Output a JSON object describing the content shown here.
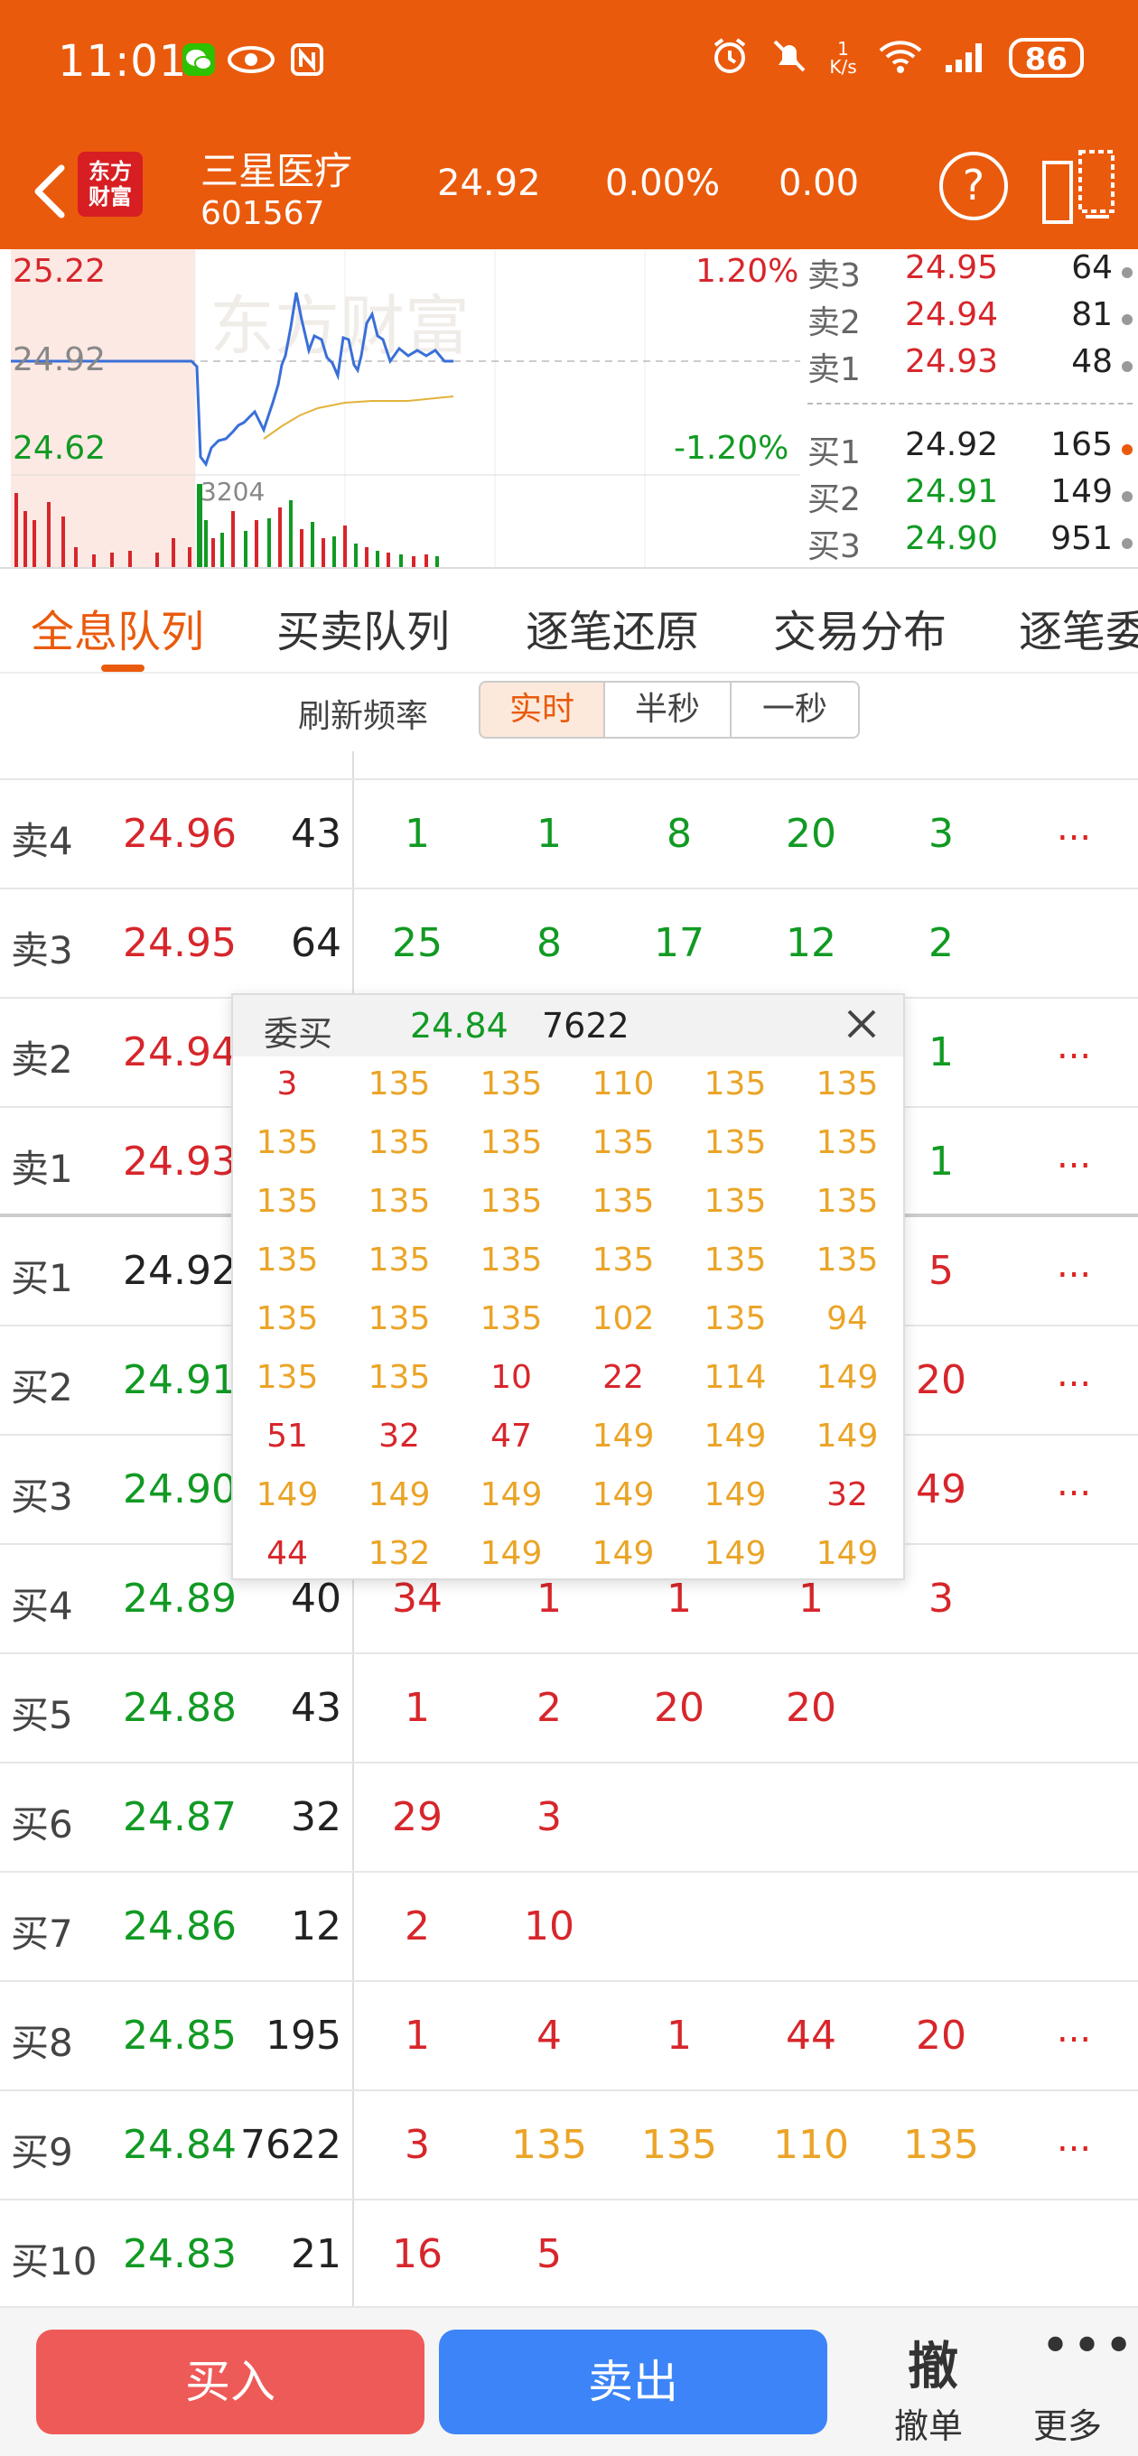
{
  "status_bar": {
    "time": "11:01",
    "net_speed_top": "1",
    "net_speed_unit": "K/s",
    "battery": "86"
  },
  "header": {
    "stock_name": "三星医疗",
    "stock_code": "601567",
    "price": "24.92",
    "change_pct": "0.00%",
    "change": "0.00",
    "logo_line1": "东方",
    "logo_line2": "财富"
  },
  "chart": {
    "high_label": "25.22",
    "mid_label": "24.92",
    "low_label": "24.62",
    "high_pct": "1.20%",
    "low_pct": "-1.20%",
    "volume_label": "3204",
    "watermark": "东方财富"
  },
  "order_book": [
    {
      "label": "卖3",
      "price": "24.95",
      "volume": "64",
      "color": "red"
    },
    {
      "label": "卖2",
      "price": "24.94",
      "volume": "81",
      "color": "red"
    },
    {
      "label": "卖1",
      "price": "24.93",
      "volume": "48",
      "color": "red"
    },
    {
      "label": "买1",
      "price": "24.92",
      "volume": "165",
      "color": "black",
      "dot": "orange"
    },
    {
      "label": "买2",
      "price": "24.91",
      "volume": "149",
      "color": "green"
    },
    {
      "label": "买3",
      "price": "24.90",
      "volume": "951",
      "color": "green"
    }
  ],
  "tabs": [
    "全息队列",
    "买卖队列",
    "逐笔还原",
    "交易分布",
    "逐笔委"
  ],
  "refresh": {
    "label": "刷新频率",
    "options": [
      "实时",
      "半秒",
      "一秒"
    ]
  },
  "queue_rows": [
    {
      "level": "卖4",
      "price": "24.96",
      "vol": "43",
      "pcolor": "red",
      "cells": [
        "1",
        "1",
        "8",
        "20",
        "3"
      ],
      "ccolor": [
        "green",
        "green",
        "green",
        "green",
        "green"
      ],
      "more": "..."
    },
    {
      "level": "卖3",
      "price": "24.95",
      "vol": "64",
      "pcolor": "red",
      "cells": [
        "25",
        "8",
        "17",
        "12",
        "2"
      ],
      "ccolor": [
        "green",
        "green",
        "green",
        "green",
        "green"
      ],
      "more": ""
    },
    {
      "level": "卖2",
      "price": "24.94",
      "vol": "",
      "pcolor": "red",
      "cells": [
        "",
        "",
        "",
        "",
        "1"
      ],
      "ccolor": [
        "green",
        "green",
        "green",
        "green",
        "green"
      ],
      "more": "..."
    },
    {
      "level": "卖1",
      "price": "24.93",
      "vol": "",
      "pcolor": "red",
      "cells": [
        "",
        "",
        "",
        "",
        "1"
      ],
      "ccolor": [
        "green",
        "green",
        "green",
        "green",
        "green"
      ],
      "more": "..."
    },
    {
      "level": "买1",
      "price": "24.92",
      "vol": "",
      "pcolor": "black",
      "cells": [
        "",
        "",
        "",
        "",
        "5"
      ],
      "ccolor": [
        "red",
        "red",
        "red",
        "red",
        "red"
      ],
      "more": "..."
    },
    {
      "level": "买2",
      "price": "24.91",
      "vol": "",
      "pcolor": "green",
      "cells": [
        "",
        "",
        "",
        "",
        "20"
      ],
      "ccolor": [
        "red",
        "red",
        "red",
        "red",
        "red"
      ],
      "more": "..."
    },
    {
      "level": "买3",
      "price": "24.90",
      "vol": "",
      "pcolor": "green",
      "cells": [
        "",
        "",
        "",
        "",
        "49"
      ],
      "ccolor": [
        "red",
        "red",
        "red",
        "red",
        "red"
      ],
      "more": "..."
    },
    {
      "level": "买4",
      "price": "24.89",
      "vol": "40",
      "pcolor": "green",
      "cells": [
        "34",
        "1",
        "1",
        "1",
        "3"
      ],
      "ccolor": [
        "red",
        "red",
        "red",
        "red",
        "red"
      ],
      "more": ""
    },
    {
      "level": "买5",
      "price": "24.88",
      "vol": "43",
      "pcolor": "green",
      "cells": [
        "1",
        "2",
        "20",
        "20",
        ""
      ],
      "ccolor": [
        "red",
        "red",
        "red",
        "red",
        "red"
      ],
      "more": ""
    },
    {
      "level": "买6",
      "price": "24.87",
      "vol": "32",
      "pcolor": "green",
      "cells": [
        "29",
        "3",
        "",
        "",
        ""
      ],
      "ccolor": [
        "red",
        "red",
        "red",
        "red",
        "red"
      ],
      "more": ""
    },
    {
      "level": "买7",
      "price": "24.86",
      "vol": "12",
      "pcolor": "green",
      "cells": [
        "2",
        "10",
        "",
        "",
        ""
      ],
      "ccolor": [
        "red",
        "red",
        "red",
        "red",
        "red"
      ],
      "more": ""
    },
    {
      "level": "买8",
      "price": "24.85",
      "vol": "195",
      "pcolor": "green",
      "cells": [
        "1",
        "4",
        "1",
        "44",
        "20"
      ],
      "ccolor": [
        "red",
        "red",
        "red",
        "red",
        "red"
      ],
      "more": "..."
    },
    {
      "level": "买9",
      "price": "24.84",
      "vol": "7622",
      "pcolor": "green",
      "cells": [
        "3",
        "135",
        "135",
        "110",
        "135"
      ],
      "ccolor": [
        "red",
        "gold",
        "gold",
        "gold",
        "gold"
      ],
      "more": "..."
    },
    {
      "level": "买10",
      "price": "24.83",
      "vol": "21",
      "pcolor": "green",
      "cells": [
        "16",
        "5",
        "",
        "",
        ""
      ],
      "ccolor": [
        "red",
        "red",
        "red",
        "red",
        "red"
      ],
      "more": ""
    }
  ],
  "popup": {
    "title": "委买",
    "price": "24.84",
    "volume": "7622",
    "grid": [
      [
        "3",
        "135",
        "135",
        "110",
        "135",
        "135"
      ],
      [
        "135",
        "135",
        "135",
        "135",
        "135",
        "135"
      ],
      [
        "135",
        "135",
        "135",
        "135",
        "135",
        "135"
      ],
      [
        "135",
        "135",
        "135",
        "135",
        "135",
        "135"
      ],
      [
        "135",
        "135",
        "135",
        "102",
        "135",
        "94"
      ],
      [
        "135",
        "135",
        "10",
        "22",
        "114",
        "149"
      ],
      [
        "51",
        "32",
        "47",
        "149",
        "149",
        "149"
      ],
      [
        "149",
        "149",
        "149",
        "149",
        "149",
        "32"
      ],
      [
        "44",
        "132",
        "149",
        "149",
        "149",
        "149"
      ]
    ],
    "grid_colors": [
      [
        "red",
        "gold",
        "gold",
        "gold",
        "gold",
        "gold"
      ],
      [
        "gold",
        "gold",
        "gold",
        "gold",
        "gold",
        "gold"
      ],
      [
        "gold",
        "gold",
        "gold",
        "gold",
        "gold",
        "gold"
      ],
      [
        "gold",
        "gold",
        "gold",
        "gold",
        "gold",
        "gold"
      ],
      [
        "gold",
        "gold",
        "gold",
        "gold",
        "gold",
        "gold"
      ],
      [
        "gold",
        "gold",
        "red",
        "red",
        "gold",
        "gold"
      ],
      [
        "red",
        "red",
        "red",
        "gold",
        "gold",
        "gold"
      ],
      [
        "gold",
        "gold",
        "gold",
        "gold",
        "gold",
        "red"
      ],
      [
        "red",
        "gold",
        "gold",
        "gold",
        "gold",
        "gold"
      ]
    ]
  },
  "bottom_bar": {
    "buy": "买入",
    "sell": "卖出",
    "cancel_icon": "撤",
    "cancel": "撤单",
    "more": "更多"
  }
}
